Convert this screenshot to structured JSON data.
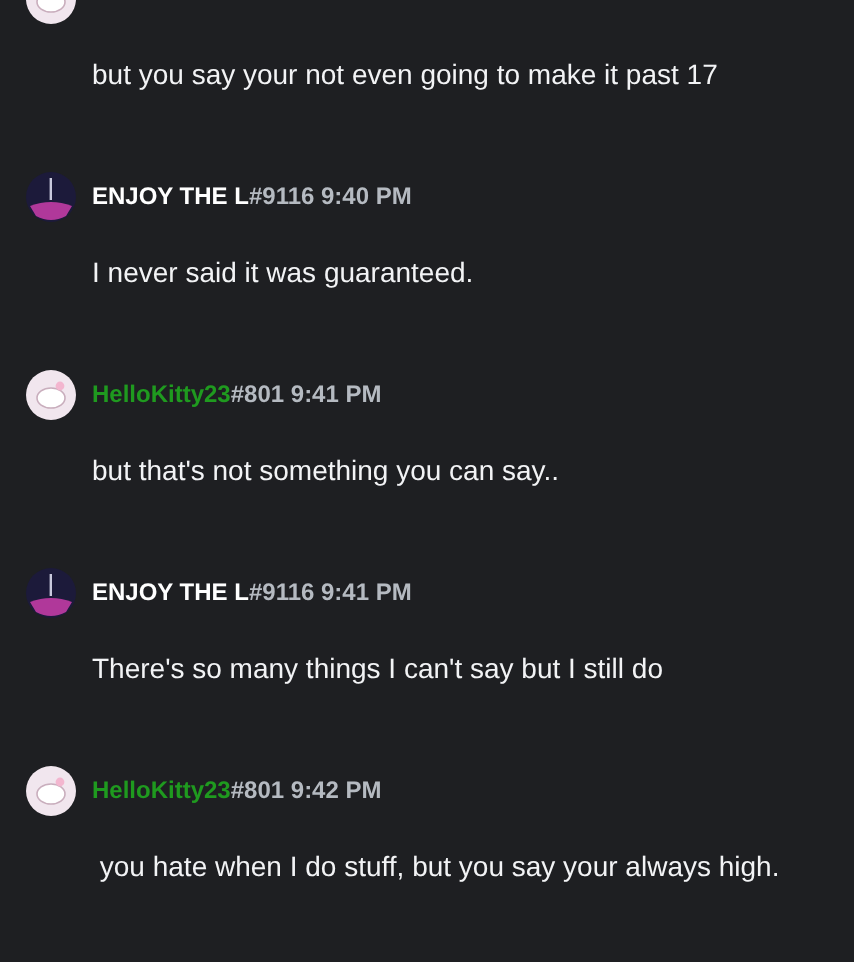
{
  "messages": [
    {
      "kind": "kitty",
      "text": "but you say your not even going to make it past 17"
    },
    {
      "kind": "night",
      "author": {
        "name": "ENJOY THE L",
        "tag": "#9116",
        "color": "#ffffff"
      },
      "time": "9:40 PM",
      "text": "I never said it was guaranteed."
    },
    {
      "kind": "kitty",
      "author": {
        "name": "HelloKitty23",
        "tag": "#801",
        "color": "#1f9a1f"
      },
      "time": "9:41 PM",
      "text": "but that's not something you can say.."
    },
    {
      "kind": "night",
      "author": {
        "name": "ENJOY THE L",
        "tag": "#9116",
        "color": "#ffffff"
      },
      "time": "9:41 PM",
      "text": "There's so many things I can't say but I still do"
    },
    {
      "kind": "kitty",
      "author": {
        "name": "HelloKitty23",
        "tag": "#801",
        "color": "#1f9a1f"
      },
      "time": "9:42 PM",
      "text": " you hate when I do stuff, but you say your always high."
    }
  ]
}
